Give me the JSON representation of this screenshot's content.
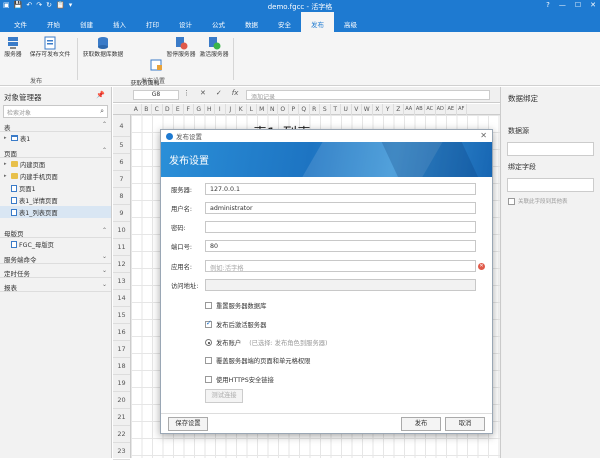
{
  "titlebar": {
    "title": "demo.fgcc - 活字格",
    "quick_access": [
      "▣",
      "💾",
      "↶",
      "↷",
      "↻",
      "📋",
      "▾"
    ],
    "window_controls": [
      "?",
      "—",
      "☐",
      "✕"
    ]
  },
  "tabs": [
    {
      "label": "文件",
      "active": false
    },
    {
      "label": "开始",
      "active": false
    },
    {
      "label": "创建",
      "active": false
    },
    {
      "label": "插入",
      "active": false
    },
    {
      "label": "打印",
      "active": false
    },
    {
      "label": "设计",
      "active": false
    },
    {
      "label": "公式",
      "active": false
    },
    {
      "label": "数据",
      "active": false
    },
    {
      "label": "安全",
      "active": false
    },
    {
      "label": "发布",
      "active": true
    },
    {
      "label": "高级",
      "active": false
    }
  ],
  "ribbon": {
    "group1": {
      "label": "发布",
      "buttons": [
        "服务器",
        "保存可发布文件"
      ]
    },
    "group2": {
      "label": "发布设置",
      "buttons": [
        "获取数据库数据",
        "获取页面和\n单元格权限",
        "暂停服务器",
        "激活服务器"
      ]
    }
  },
  "left_panel": {
    "title": "对象管理器",
    "pin_icon": "pin-icon",
    "search_placeholder": "检索对象",
    "sections": {
      "tables": {
        "label": "表",
        "items": [
          "表1"
        ]
      },
      "pages": {
        "label": "页面",
        "items": [
          "内建页面",
          "内建手机页面",
          "页面1",
          "表1_详情页面",
          "表1_列表页面"
        ]
      },
      "master": {
        "label": "母版页",
        "items": [
          "FGC_母版页"
        ]
      },
      "server_cmd": {
        "label": "服务端命令"
      },
      "schedule": {
        "label": "定时任务"
      },
      "report": {
        "label": "报表"
      }
    }
  },
  "formula_bar": {
    "cell_ref": "G8",
    "placeholder": "添加记录",
    "fx": "fx"
  },
  "columns": [
    "A",
    "B",
    "C",
    "D",
    "E",
    "F",
    "G",
    "H",
    "I",
    "J",
    "K",
    "L",
    "M",
    "N",
    "O",
    "P",
    "Q",
    "R",
    "S",
    "T",
    "U",
    "V",
    "W",
    "X",
    "Y",
    "Z",
    "AA",
    "AB",
    "AC",
    "AD",
    "AE",
    "AF"
  ],
  "rows": [
    "4",
    "5",
    "6",
    "7",
    "8",
    "9",
    "10",
    "11",
    "12",
    "13",
    "14",
    "15",
    "16",
    "17",
    "18",
    "19",
    "20",
    "21",
    "22",
    "23"
  ],
  "bg_title": "表1_列表",
  "right_panel": {
    "title": "数据绑定",
    "datasource_label": "数据源",
    "bindfield_label": "绑定字段",
    "checkbox_label": "关联此字段到其他表"
  },
  "dialog": {
    "titlebar": "发布设置",
    "banner": "发布设置",
    "fields": {
      "server": {
        "label": "服务器:",
        "value": "127.0.0.1"
      },
      "username": {
        "label": "用户名:",
        "value": "administrator"
      },
      "password": {
        "label": "密码:",
        "value": ""
      },
      "port": {
        "label": "端口号:",
        "value": "80"
      },
      "appname": {
        "label": "应用名:",
        "placeholder": "例如:活字格"
      },
      "url": {
        "label": "访问地址:",
        "value": ""
      }
    },
    "options": {
      "overwrite_db": "重置服务器数据库",
      "activate_after": "发布后激活服务器",
      "publish_account": "发布账户",
      "publish_hint": "(已选择: 发布角色到服务器)",
      "overwrite_perms": "覆盖服务器端的页面和单元格权限",
      "https": "使用HTTPS安全链接"
    },
    "test_button": "测试连接",
    "save_button": "保存设置",
    "publish_button": "发布",
    "cancel_button": "取消"
  }
}
